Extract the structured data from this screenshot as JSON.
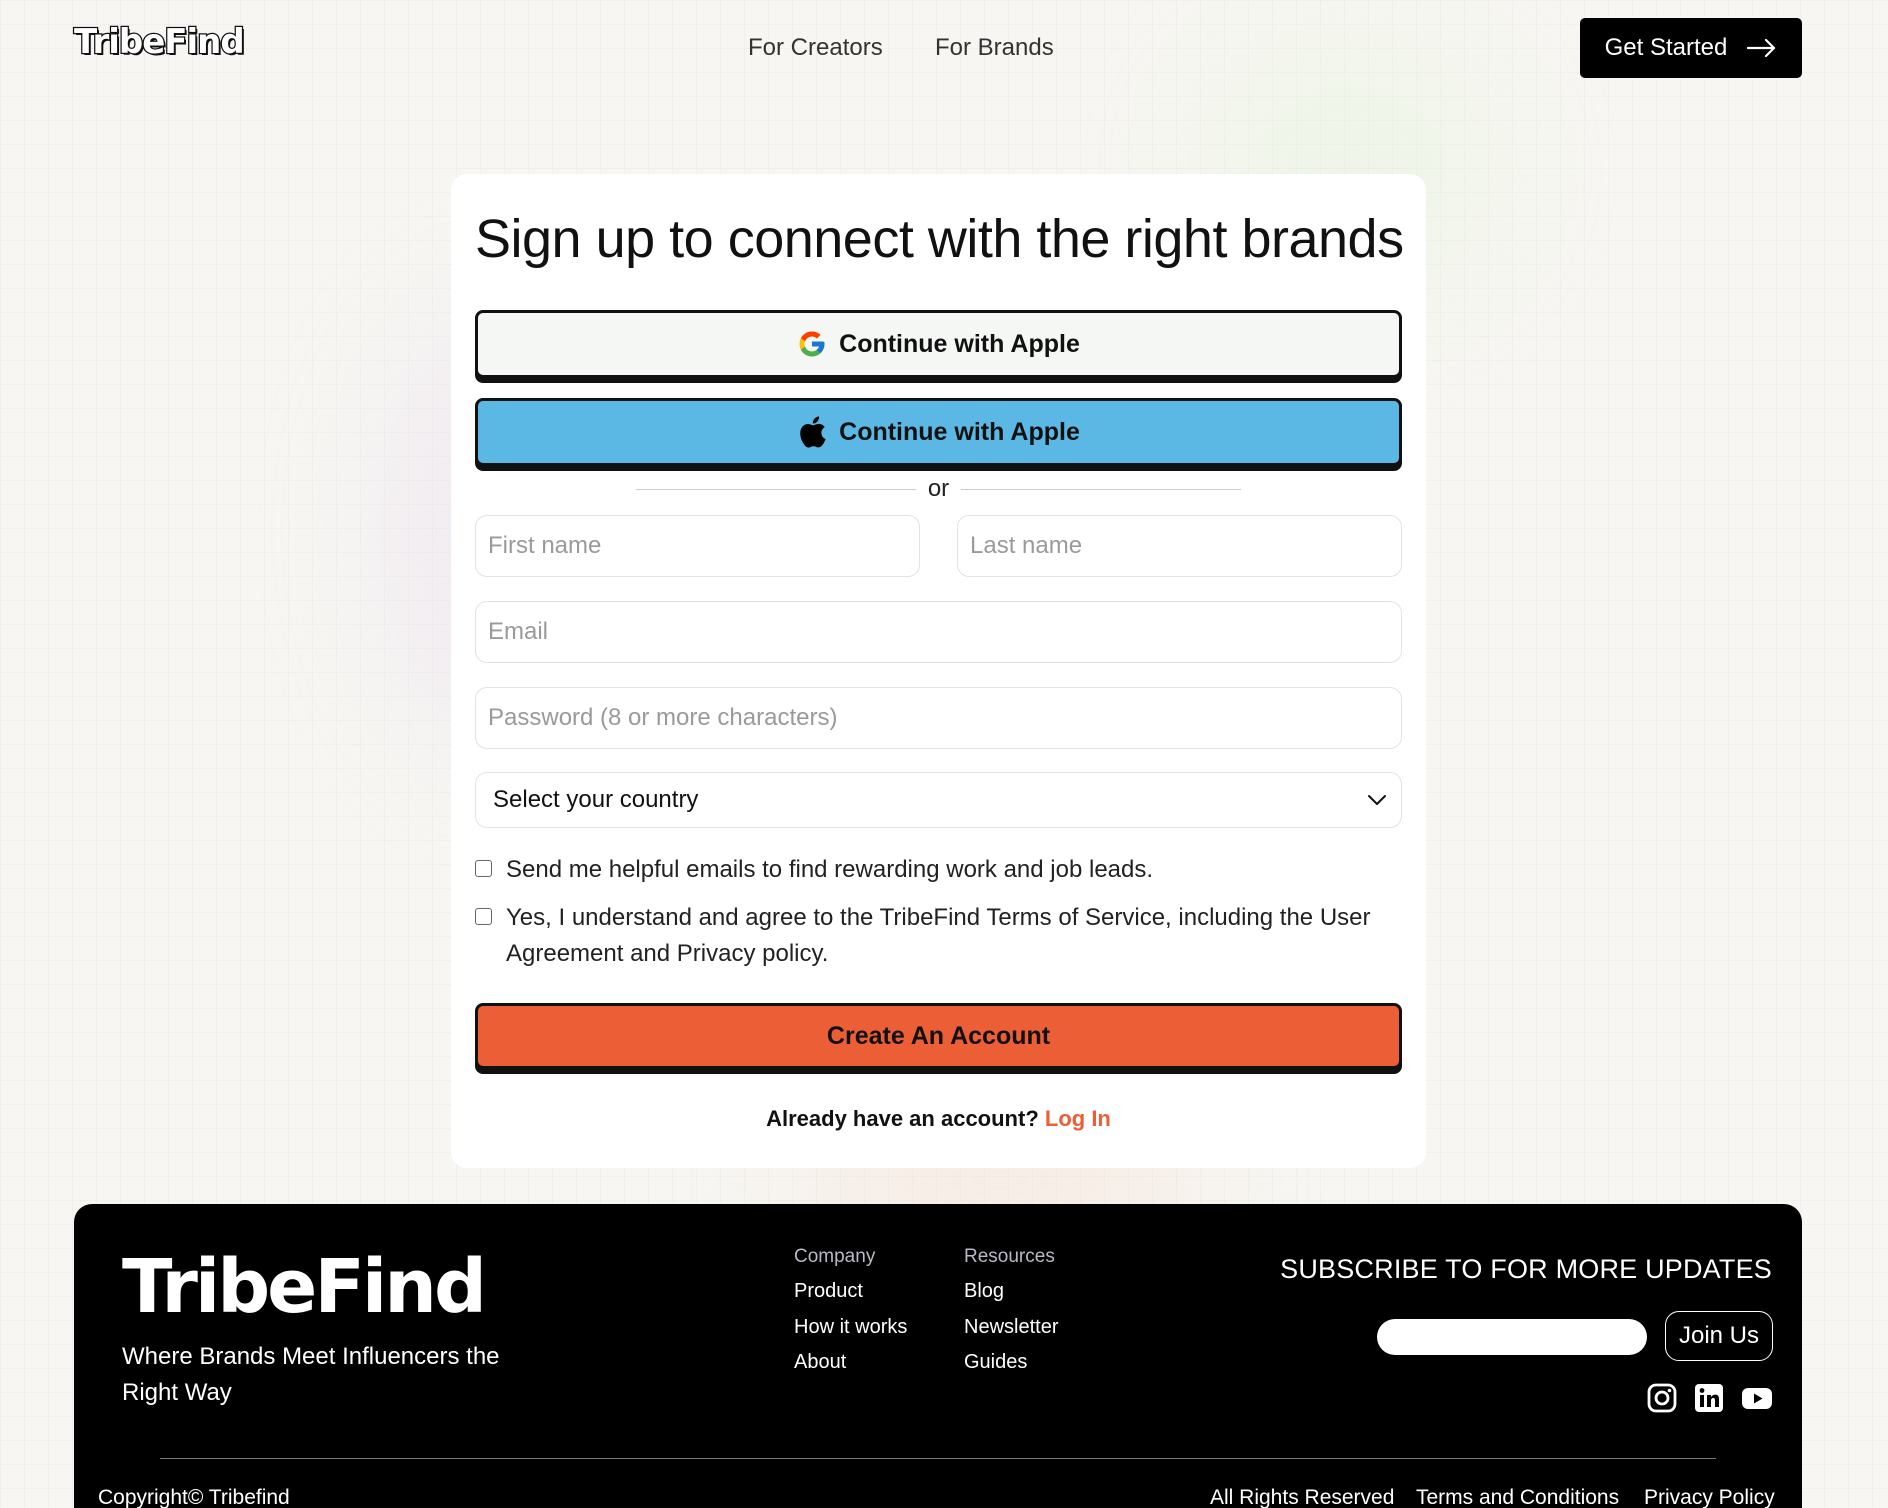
{
  "header": {
    "logo": "TribeFind",
    "nav": [
      "For Creators",
      "For Brands"
    ],
    "cta_label": "Get Started"
  },
  "signup": {
    "title": "Sign up to connect with the right brands",
    "google_label": "Continue with Apple",
    "apple_label": "Continue with Apple",
    "divider": "or",
    "first_name_placeholder": "First name",
    "last_name_placeholder": "Last name",
    "email_placeholder": "Email",
    "password_placeholder": "Password (8 or more characters)",
    "country_select": "Select your country",
    "check_emails": "Send me helpful emails to find rewarding work and job leads.",
    "check_terms": "Yes, I understand and agree to the TribeFind Terms of Service, including the User Agreement and Privacy policy.",
    "create_label": "Create An Account",
    "already_text": "Already have an account?",
    "login_label": "Log In"
  },
  "colors": {
    "accent_orange": "#ec5e35",
    "apple_blue": "#5bb8e5",
    "google_bg": "#f4f7f4"
  },
  "footer": {
    "logo": "TribeFind",
    "tagline": "Where Brands Meet Influencers the Right Way",
    "company_heading": "Company",
    "company_links": [
      "Product",
      "How it works",
      "About"
    ],
    "resources_heading": "Resources",
    "resources_links": [
      "Blog",
      "Newsletter",
      "Guides"
    ],
    "subscribe_heading": "SUBSCRIBE TO FOR MORE UPDATES",
    "join_label": "Join Us",
    "social_icons": [
      "instagram-icon",
      "linkedin-icon",
      "youtube-icon"
    ],
    "copyright": "Copyright© Tribefind",
    "rights": "All Rights Reserved",
    "terms": "Terms and Conditions",
    "privacy": "Privacy Policy"
  }
}
